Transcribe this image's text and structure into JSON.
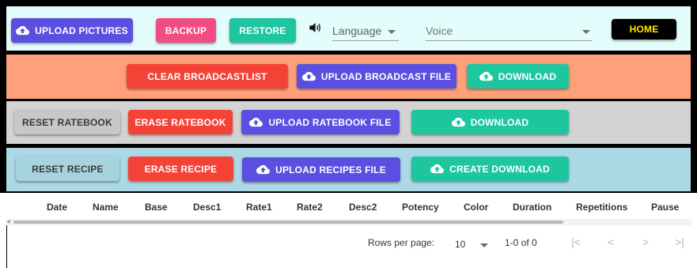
{
  "colors": {
    "toolbar_bg": "#e3fdfd",
    "broadcast_bg": "#ffa07a",
    "ratebook_bg": "#d3d3d3",
    "recipe_bg": "#add8e6",
    "purple": "#5a4fe0",
    "pink": "#f24c84",
    "teal": "#1ec6a0",
    "red": "#f44336",
    "home_text": "#ffea00"
  },
  "toolbar": {
    "upload_pictures": "UPLOAD PICTURES",
    "backup": "BACKUP",
    "restore": "RESTORE",
    "language_placeholder": "Language",
    "voice_placeholder": "Voice",
    "home": "HOME",
    "icons": [
      "cloud-upload-icon",
      "speaker-icon",
      "caret-down-icon"
    ]
  },
  "broadcast": {
    "clear": "CLEAR BROADCASTLIST",
    "upload": "UPLOAD BROADCAST FILE",
    "download": "DOWNLOAD"
  },
  "ratebook": {
    "reset": "RESET RATEBOOK",
    "erase": "ERASE RATEBOOK",
    "upload": "UPLOAD RATEBOOK FILE",
    "download": "DOWNLOAD"
  },
  "recipe": {
    "reset": "RESET RECIPE",
    "erase": "ERASE RECIPE",
    "upload": "UPLOAD RECIPES FILE",
    "create_download": "CREATE DOWNLOAD"
  },
  "table": {
    "columns": [
      "Date",
      "Name",
      "Base",
      "Desc1",
      "Rate1",
      "Rate2",
      "Desc2",
      "Potency",
      "Color",
      "Duration",
      "Repetitions",
      "Pause"
    ]
  },
  "pagination": {
    "rows_per_page_label": "Rows per page:",
    "rows_per_page_value": "10",
    "range": "1-0 of 0",
    "first": "|<",
    "prev": "<",
    "next": ">",
    "last": ">|"
  }
}
